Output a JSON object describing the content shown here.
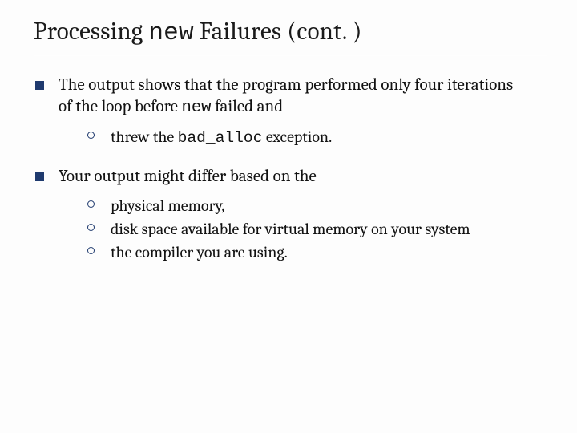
{
  "title": {
    "pre": "Processing ",
    "mono": "new",
    "post": " Failures (cont. )"
  },
  "items": [
    {
      "text": {
        "pre": "The output shows that the program performed only four iterations of the loop before ",
        "mono": "new",
        "post": " failed and"
      },
      "subs": [
        {
          "pre": "threw the ",
          "mono": "bad_alloc",
          "post": " exception."
        }
      ]
    },
    {
      "text": {
        "pre": "Your output might differ based on the",
        "mono": "",
        "post": ""
      },
      "subs": [
        {
          "pre": "physical memory,",
          "mono": "",
          "post": ""
        },
        {
          "pre": "disk space available for virtual memory on your system",
          "mono": "",
          "post": ""
        },
        {
          "pre": "the compiler you are using.",
          "mono": "",
          "post": ""
        }
      ]
    }
  ]
}
